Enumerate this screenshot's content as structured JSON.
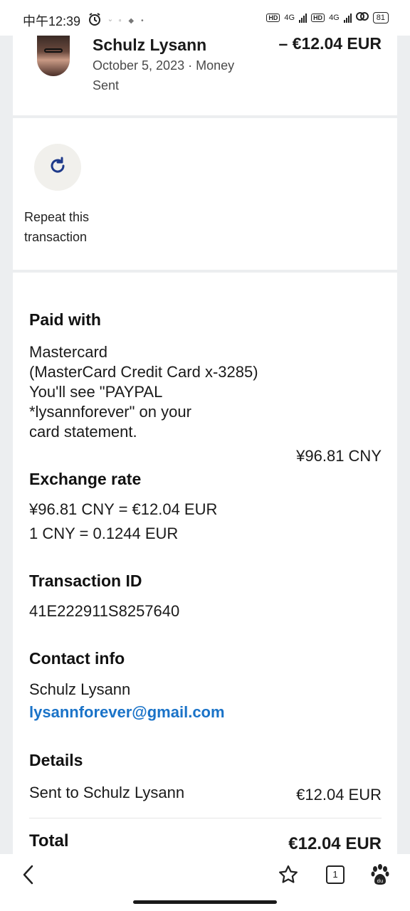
{
  "status_bar": {
    "time": "中午12:39",
    "network_1": "HD",
    "gen_1": "4G",
    "network_2": "HD",
    "gen_2": "4G",
    "battery": "81"
  },
  "transaction": {
    "name": "Schulz Lysann",
    "date": "October 5, 2023 · Money Sent",
    "amount": "– €12.04 EUR"
  },
  "repeat": {
    "label": "Repeat this transaction"
  },
  "paid_with": {
    "heading": "Paid with",
    "line1": "Mastercard",
    "line2": "(MasterCard Credit Card x-3285)",
    "line3": "You'll see \"PAYPAL",
    "line4": "*lysannforever\" on your",
    "line5": "card statement.",
    "amount": "¥96.81 CNY"
  },
  "exchange_rate": {
    "heading": "Exchange rate",
    "line1": "¥96.81 CNY = €12.04 EUR",
    "line2": "1 CNY = 0.1244 EUR"
  },
  "transaction_id": {
    "heading": "Transaction ID",
    "value": "41E222911S8257640"
  },
  "contact_info": {
    "heading": "Contact info",
    "name": "Schulz Lysann",
    "email": "lysannforever@gmail.com"
  },
  "details": {
    "heading": "Details",
    "sent_to": "Sent to Schulz Lysann",
    "sent_amount": "€12.04 EUR",
    "total_label": "Total",
    "total_amount": "€12.04 EUR"
  },
  "bottom_nav": {
    "tabs_count": "1"
  },
  "colors": {
    "link": "#1a73c8",
    "repeat_icon": "#1e3a8a"
  }
}
